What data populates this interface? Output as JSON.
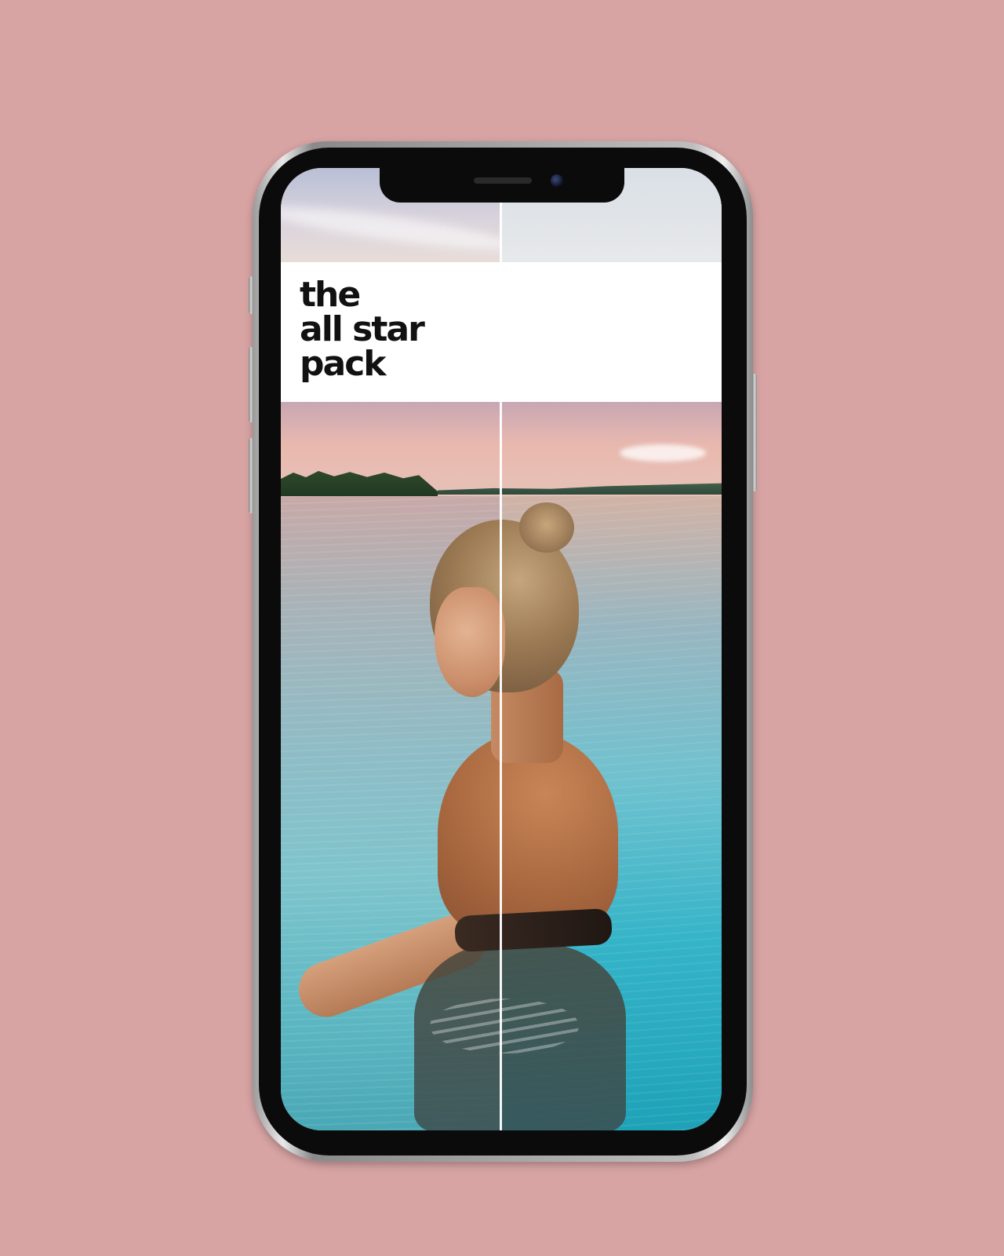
{
  "poster": {
    "title_lines": [
      "the",
      "all star",
      "pack"
    ],
    "colors": {
      "background": "#d7a3a3",
      "band": "#ffffff",
      "title_text": "#111111",
      "divider": "#ffffff"
    }
  },
  "device": {
    "type": "phone-mockup"
  }
}
